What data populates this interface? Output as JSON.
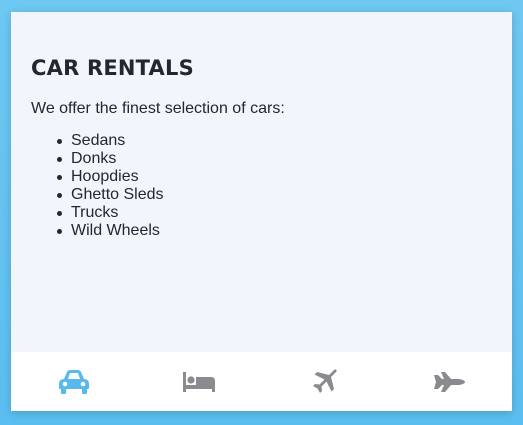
{
  "page": {
    "title": "CAR RENTALS",
    "intro": "We offer the finest selection of cars:"
  },
  "cars": [
    "Sedans",
    "Donks",
    "Hoopdies",
    "Ghetto Sleds",
    "Trucks",
    "Wild Wheels"
  ],
  "tabs": [
    {
      "icon": "car-icon",
      "active": true
    },
    {
      "icon": "bed-icon",
      "active": false
    },
    {
      "icon": "airplane-icon",
      "active": false
    },
    {
      "icon": "jet-icon",
      "active": false
    }
  ],
  "colors": {
    "active_tab": "#5ab8f0",
    "inactive_tab": "#8a8a8f",
    "panel_bg": "#f0f6fc",
    "backdrop": "#6ec8f2"
  }
}
